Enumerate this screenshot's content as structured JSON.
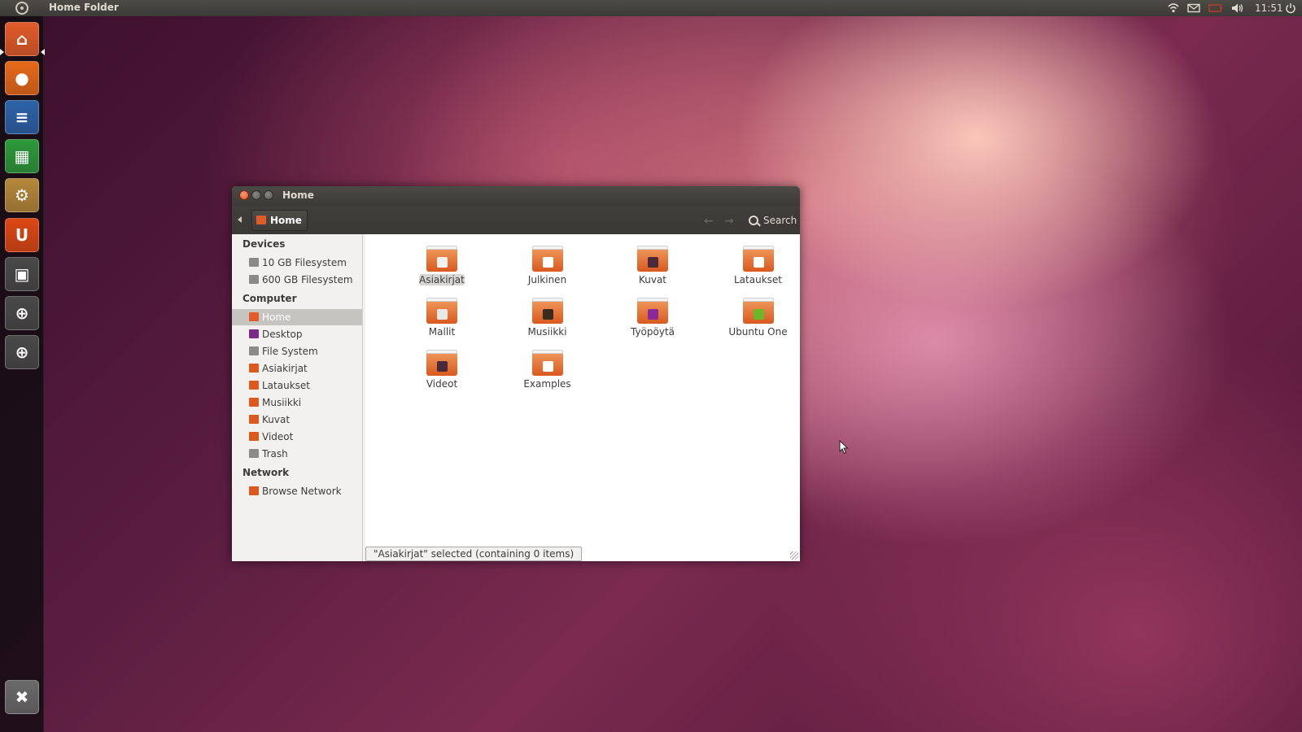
{
  "top_panel": {
    "app_title": "Home Folder",
    "clock": "11:51",
    "tray_icons": [
      "wifi-icon",
      "mail-icon",
      "battery-icon",
      "volume-icon",
      "power-icon"
    ]
  },
  "launcher": {
    "items": [
      {
        "name": "home-folder",
        "icon": "home-folder-icon",
        "color": "#e25c2a"
      },
      {
        "name": "firefox",
        "icon": "firefox-icon",
        "color": "#e66a1a"
      },
      {
        "name": "writer",
        "icon": "writer-icon",
        "color": "#2d63a8"
      },
      {
        "name": "calc",
        "icon": "calc-icon",
        "color": "#2d9a3b"
      },
      {
        "name": "software-center",
        "icon": "software-center-icon",
        "color": "#b5893b"
      },
      {
        "name": "ubuntu-one",
        "icon": "ubuntu-one-icon",
        "color": "#dd4814"
      },
      {
        "name": "workspaces",
        "icon": "workspace-switcher-icon",
        "color": "#4a4a4a"
      },
      {
        "name": "dash-applications",
        "icon": "applications-lens-icon",
        "color": "#4a4a4a"
      },
      {
        "name": "dash-files",
        "icon": "files-lens-icon",
        "color": "#4a4a4a"
      },
      {
        "name": "trash",
        "icon": "trash-icon",
        "color": "#6a6a6a"
      }
    ]
  },
  "window": {
    "title": "Home",
    "breadcrumb": "Home",
    "search_label": "Search"
  },
  "sidebar": {
    "sections": [
      {
        "header": "Devices",
        "items": [
          {
            "label": "10 GB Filesystem",
            "icon": "drive-icon",
            "color": "#8a8a8a"
          },
          {
            "label": "600 GB Filesystem",
            "icon": "drive-icon",
            "color": "#8a8a8a"
          }
        ]
      },
      {
        "header": "Computer",
        "items": [
          {
            "label": "Home",
            "icon": "home-icon",
            "color": "#e25c2a",
            "selected": true
          },
          {
            "label": "Desktop",
            "icon": "desktop-icon",
            "color": "#7a2a8a"
          },
          {
            "label": "File System",
            "icon": "filesystem-icon",
            "color": "#8a8a8a"
          },
          {
            "label": "Asiakirjat",
            "icon": "documents-folder-icon",
            "color": "#d9591f"
          },
          {
            "label": "Lataukset",
            "icon": "downloads-folder-icon",
            "color": "#d9591f"
          },
          {
            "label": "Musiikki",
            "icon": "music-folder-icon",
            "color": "#d9591f"
          },
          {
            "label": "Kuvat",
            "icon": "pictures-folder-icon",
            "color": "#d9591f"
          },
          {
            "label": "Videot",
            "icon": "videos-folder-icon",
            "color": "#d9591f"
          },
          {
            "label": "Trash",
            "icon": "trash-icon",
            "color": "#8a8a8a"
          }
        ]
      },
      {
        "header": "Network",
        "items": [
          {
            "label": "Browse Network",
            "icon": "network-icon",
            "color": "#d9591f"
          }
        ]
      }
    ]
  },
  "files": [
    {
      "label": "Asiakirjat",
      "icon": "documents-folder-icon",
      "emblem": "#f0f0f0",
      "selected": true
    },
    {
      "label": "Julkinen",
      "icon": "public-folder-icon",
      "emblem": "#ffffff"
    },
    {
      "label": "Kuvat",
      "icon": "pictures-folder-icon",
      "emblem": "#4a2a3a"
    },
    {
      "label": "Lataukset",
      "icon": "downloads-folder-icon",
      "emblem": "#ffffff"
    },
    {
      "label": "Mallit",
      "icon": "templates-folder-icon",
      "emblem": "#e8e8e8"
    },
    {
      "label": "Musiikki",
      "icon": "music-folder-icon",
      "emblem": "#3a2a20"
    },
    {
      "label": "Työpöytä",
      "icon": "desktop-folder-icon",
      "emblem": "#8a2a9a"
    },
    {
      "label": "Ubuntu One",
      "icon": "ubuntu-one-folder-icon",
      "emblem": "#6ab82a"
    },
    {
      "label": "Videot",
      "icon": "videos-folder-icon",
      "emblem": "#4a2a3a"
    },
    {
      "label": "Examples",
      "icon": "examples-folder-icon",
      "emblem": "#ffffff"
    }
  ],
  "status": "\"Asiakirjat\" selected (containing 0 items)"
}
